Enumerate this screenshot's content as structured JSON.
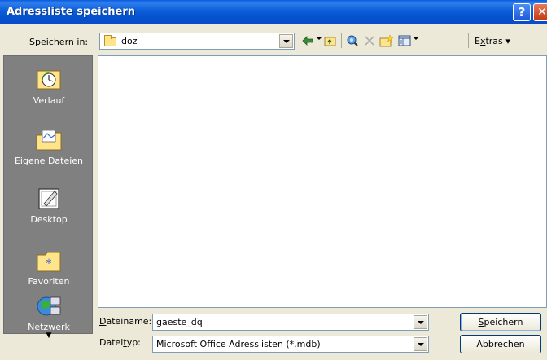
{
  "window": {
    "title": "Adressliste speichern"
  },
  "toolbar": {
    "save_in_label_prefix": "Speichern ",
    "save_in_label_accel": "i",
    "save_in_label_suffix": "n:",
    "folder_value": "doz",
    "extras_accel": "x",
    "extras_prefix": "E",
    "extras_suffix": "tras",
    "icons": [
      "back-arrow-icon",
      "up-folder-icon",
      "search-web-icon",
      "delete-icon",
      "new-folder-icon",
      "views-icon"
    ]
  },
  "places": [
    {
      "label": "Verlauf",
      "icon": "history-icon"
    },
    {
      "label": "Eigene Dateien",
      "icon": "my-documents-icon"
    },
    {
      "label": "Desktop",
      "icon": "desktop-icon"
    },
    {
      "label": "Favoriten",
      "icon": "favorites-icon"
    },
    {
      "label": "Netzwerk",
      "icon": "network-icon"
    }
  ],
  "fields": {
    "filename_label_accel": "D",
    "filename_label_rest": "ateiname:",
    "filename_value": "gaeste_dq",
    "filetype_label_prefix": "Datei",
    "filetype_label_accel": "t",
    "filetype_label_suffix": "yp:",
    "filetype_value": "Microsoft Office Adresslisten (*.mdb)"
  },
  "buttons": {
    "save_accel": "S",
    "save_rest": "peichern",
    "cancel": "Abbrechen"
  }
}
